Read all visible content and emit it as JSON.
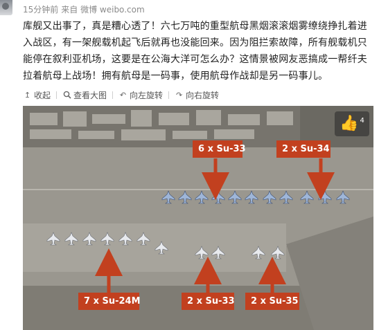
{
  "post": {
    "time": "15分钟前",
    "source": "来自 微博 weibo.com",
    "text": "库舰又出事了，真是糟心透了！六七万吨的重型航母黑烟滚滚烟雾缭绕挣扎着进入战区，有一架舰载机起飞后就再也没能回来。因为阻拦索故障，所有舰载机只能停在叙利亚机场，这要是在公海大洋可怎么办？这情景被网友恶搞成一帮纤夫拉着航母上战场！拥有航母是一码事，使用航母作战却是另一码事儿。"
  },
  "toolbar": {
    "collapse": "收起",
    "view_large": "查看大图",
    "rotate_left": "向左旋转",
    "rotate_right": "向右旋转"
  },
  "photo": {
    "like_count": "4",
    "labels": {
      "su33_top": "6 x Su-33",
      "su34": "2 x Su-34",
      "su24m": "7 x Su-24M",
      "su33_bottom": "2 x Su-33",
      "su35": "2 x Su-35"
    },
    "label_color": "#c2401f"
  }
}
